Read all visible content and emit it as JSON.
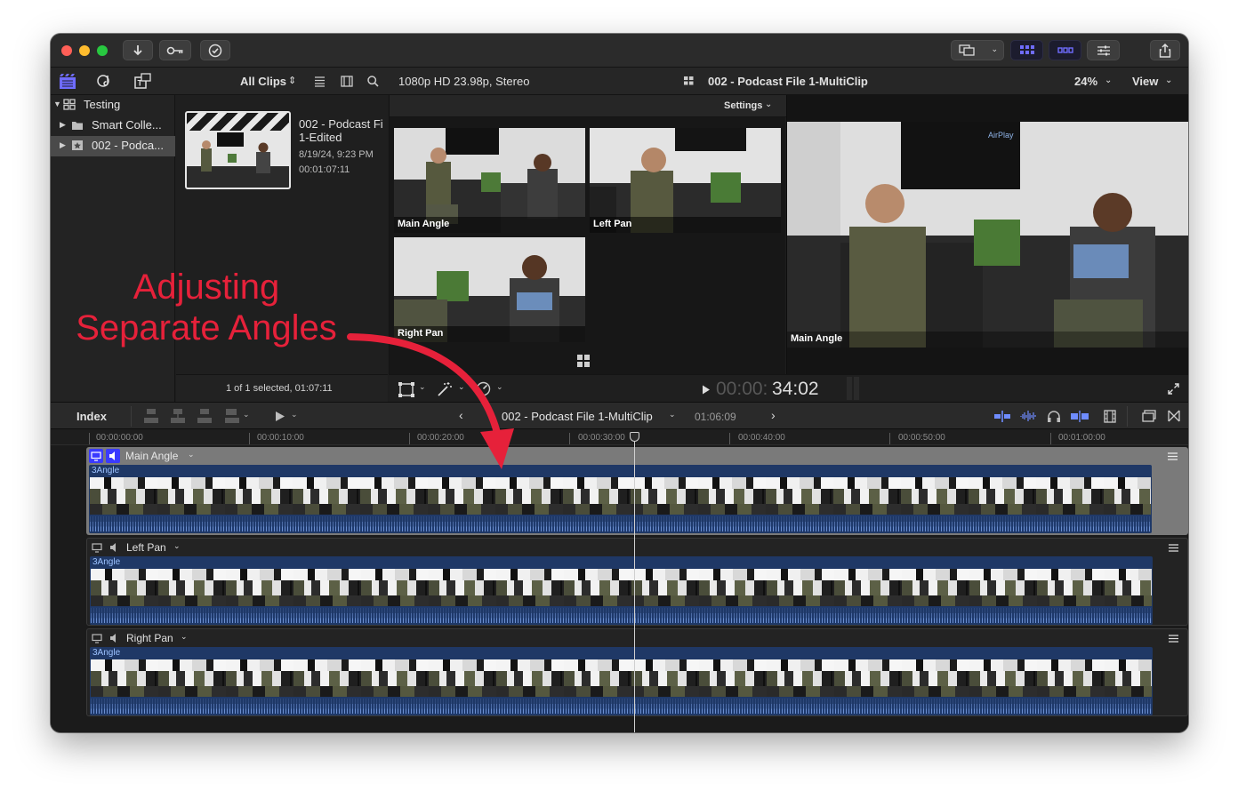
{
  "annotation": {
    "line1": "Adjusting",
    "line2": "Separate Angles",
    "color": "#e6213a"
  },
  "titlebar": {
    "buttons": [
      "import-icon",
      "keywords-icon",
      "background-tasks-icon",
      "layout-icon",
      "browser-layout-icon",
      "timeline-layout-icon",
      "inspector-icon",
      "share-icon"
    ]
  },
  "browser_header": {
    "filter_label": "All Clips"
  },
  "viewer_header": {
    "format": "1080p HD 23.98p, Stereo",
    "clip_name": "002 - Podcast File 1-MultiClip",
    "zoom": "24%",
    "view_label": "View"
  },
  "library": {
    "items": [
      {
        "label": "Testing"
      },
      {
        "label": "Smart Colle..."
      },
      {
        "label": "002 - Podca..."
      }
    ]
  },
  "browser": {
    "clip": {
      "name_line1": "002 - Podcast Fi",
      "name_line2": "1-Edited",
      "date": "8/19/24, 9:23 PM",
      "duration": "00:01:07:11"
    },
    "footer": "1 of 1 selected, 01:07:11"
  },
  "angle_viewer": {
    "settings_label": "Settings",
    "angles": [
      {
        "label": "Main Angle"
      },
      {
        "label": "Left Pan"
      },
      {
        "label": "Right Pan"
      }
    ]
  },
  "viewer": {
    "angle_label": "Main Angle",
    "airplay_text": "AirPlay"
  },
  "transport": {
    "timecode_dim": "00:00:",
    "timecode_bright": "34:02"
  },
  "timeline": {
    "index_label": "Index",
    "title": "002 - Podcast File 1-MultiClip",
    "duration": "01:06:09",
    "ruler": [
      "00:00:00:00",
      "00:00:10:00",
      "00:00:20:00",
      "00:00:30:00",
      "00:00:40:00",
      "00:00:50:00",
      "00:01:00:00"
    ],
    "lanes": [
      {
        "name": "Main Angle",
        "clip": "3Angle",
        "active": true
      },
      {
        "name": "Left Pan",
        "clip": "3Angle",
        "active": false
      },
      {
        "name": "Right Pan",
        "clip": "3Angle",
        "active": false
      }
    ]
  }
}
